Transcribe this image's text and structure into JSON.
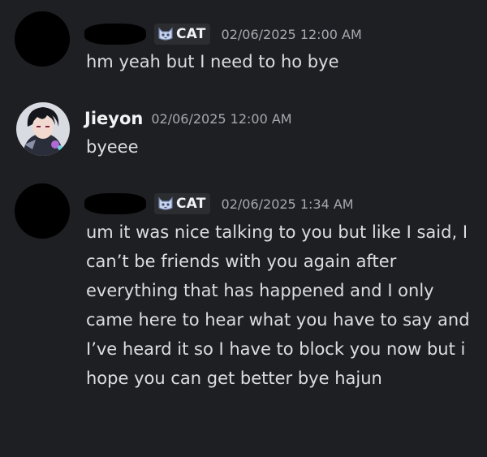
{
  "messages": [
    {
      "author": "",
      "tag": "CAT",
      "timestamp": "02/06/2025 12:00 AM",
      "text": "hm yeah but I need to ho bye"
    },
    {
      "author": "Jieyon",
      "timestamp": "02/06/2025 12:00 AM",
      "text": "byeee"
    },
    {
      "author": "",
      "tag": "CAT",
      "timestamp": "02/06/2025 1:34 AM",
      "text": "um it was nice talking to you but like I said, I can’t be friends with you again after everything that has happened and I only came here to hear what you have to say and I’ve heard it so I have to block you now but i hope you can get better bye hajun"
    }
  ],
  "icons": {
    "tag": "cat-face-icon",
    "avatar": "anime-character-avatar-icon"
  },
  "colors": {
    "background": "#1e1f22",
    "text": "#dbdee1",
    "timestamp": "#a7a9b0",
    "tag_background": "#2b2d31"
  }
}
